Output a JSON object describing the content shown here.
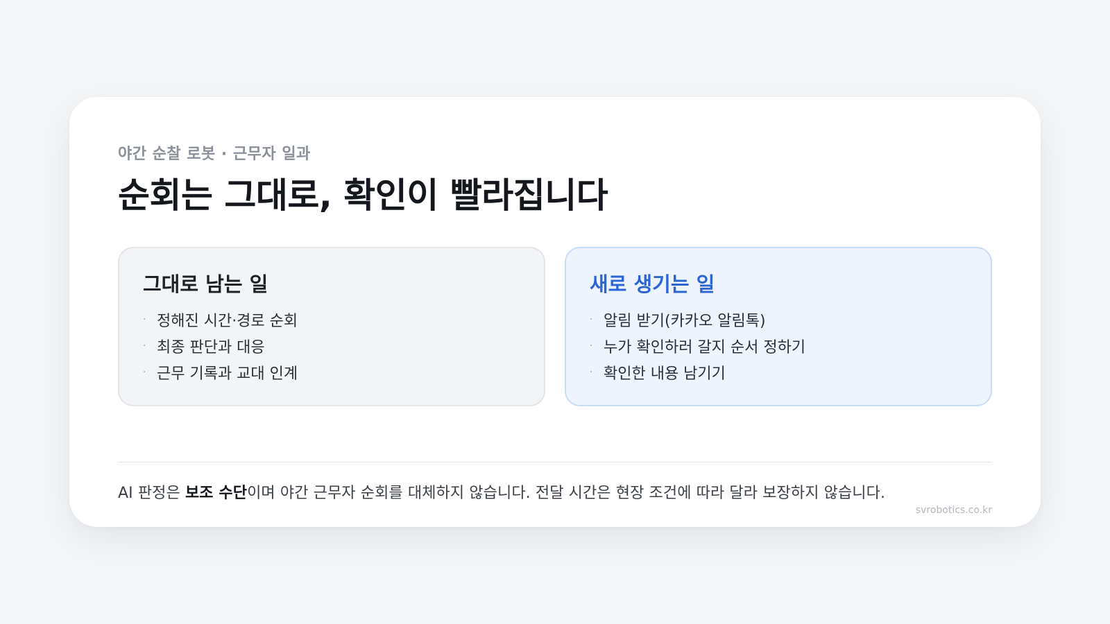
{
  "eyebrow": "야간 순찰 로봇 · 근무자 일과",
  "title": "순회는 그대로, 확인이 빨라집니다",
  "left": {
    "heading": "그대로 남는 일",
    "items": [
      "정해진 시간·경로 순회",
      "최종 판단과 대응",
      "근무 기록과 교대 인계"
    ]
  },
  "right": {
    "heading": "새로 생기는 일",
    "items": [
      "알림 받기(카카오 알림톡)",
      "누가 확인하러 갈지 순서 정하기",
      "확인한 내용 남기기"
    ]
  },
  "note": {
    "prefix": "AI 판정은 ",
    "emphasis": "보조 수단",
    "suffix": "이며 야간 근무자 순회를 대체하지 않습니다. 전달 시간은 현장 조건에 따라 달라 보장하지 않습니다."
  },
  "site": "svrobotics.co.kr",
  "colors": {
    "accent": "#2c66d4",
    "right_bg": "#edf4fe",
    "left_bg": "#f3f4f6"
  }
}
